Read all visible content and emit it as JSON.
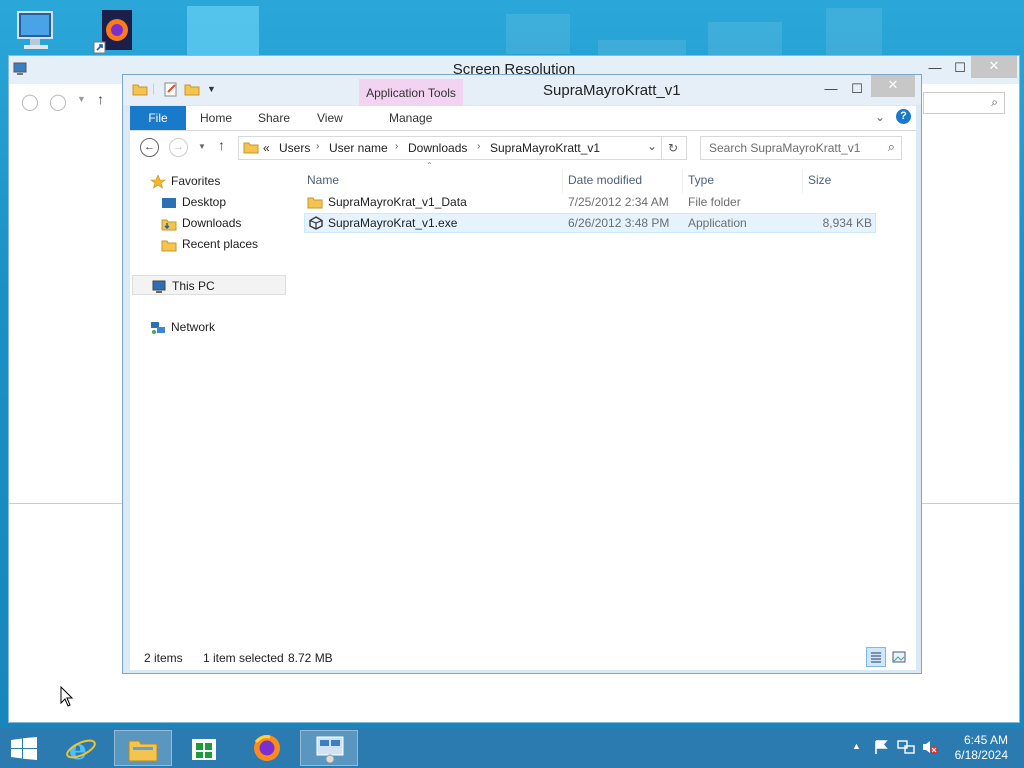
{
  "screen_resolution_window": {
    "title": "Screen Resolution"
  },
  "explorer": {
    "title": "SupraMayroKratt_v1",
    "context_tab": "Application Tools",
    "ribbon_tabs": {
      "file": "File",
      "home": "Home",
      "share": "Share",
      "view": "View",
      "manage": "Manage"
    },
    "address": {
      "overflow": "«",
      "crumbs": [
        "Users",
        "User name",
        "Downloads",
        "SupraMayroKratt_v1"
      ]
    },
    "search_placeholder": "Search SupraMayroKratt_v1",
    "nav": {
      "favorites": "Favorites",
      "desktop": "Desktop",
      "downloads": "Downloads",
      "recent": "Recent places",
      "this_pc": "This PC",
      "network": "Network"
    },
    "columns": {
      "name": "Name",
      "date": "Date modified",
      "type": "Type",
      "size": "Size"
    },
    "files": [
      {
        "name": "SupraMayroKrat_v1_Data",
        "date": "7/25/2012 2:34 AM",
        "type": "File folder",
        "size": ""
      },
      {
        "name": "SupraMayroKrat_v1.exe",
        "date": "6/26/2012 3:48 PM",
        "type": "Application",
        "size": "8,934 KB"
      }
    ],
    "status": {
      "count": "2 items",
      "selected": "1 item selected",
      "size": "8.72 MB"
    }
  },
  "taskbar": {
    "time": "6:45 AM",
    "date": "6/18/2024"
  },
  "colors": {
    "accent": "#1979ca",
    "selection": "#cce8ff",
    "context_tab": "#f2d3f2"
  }
}
